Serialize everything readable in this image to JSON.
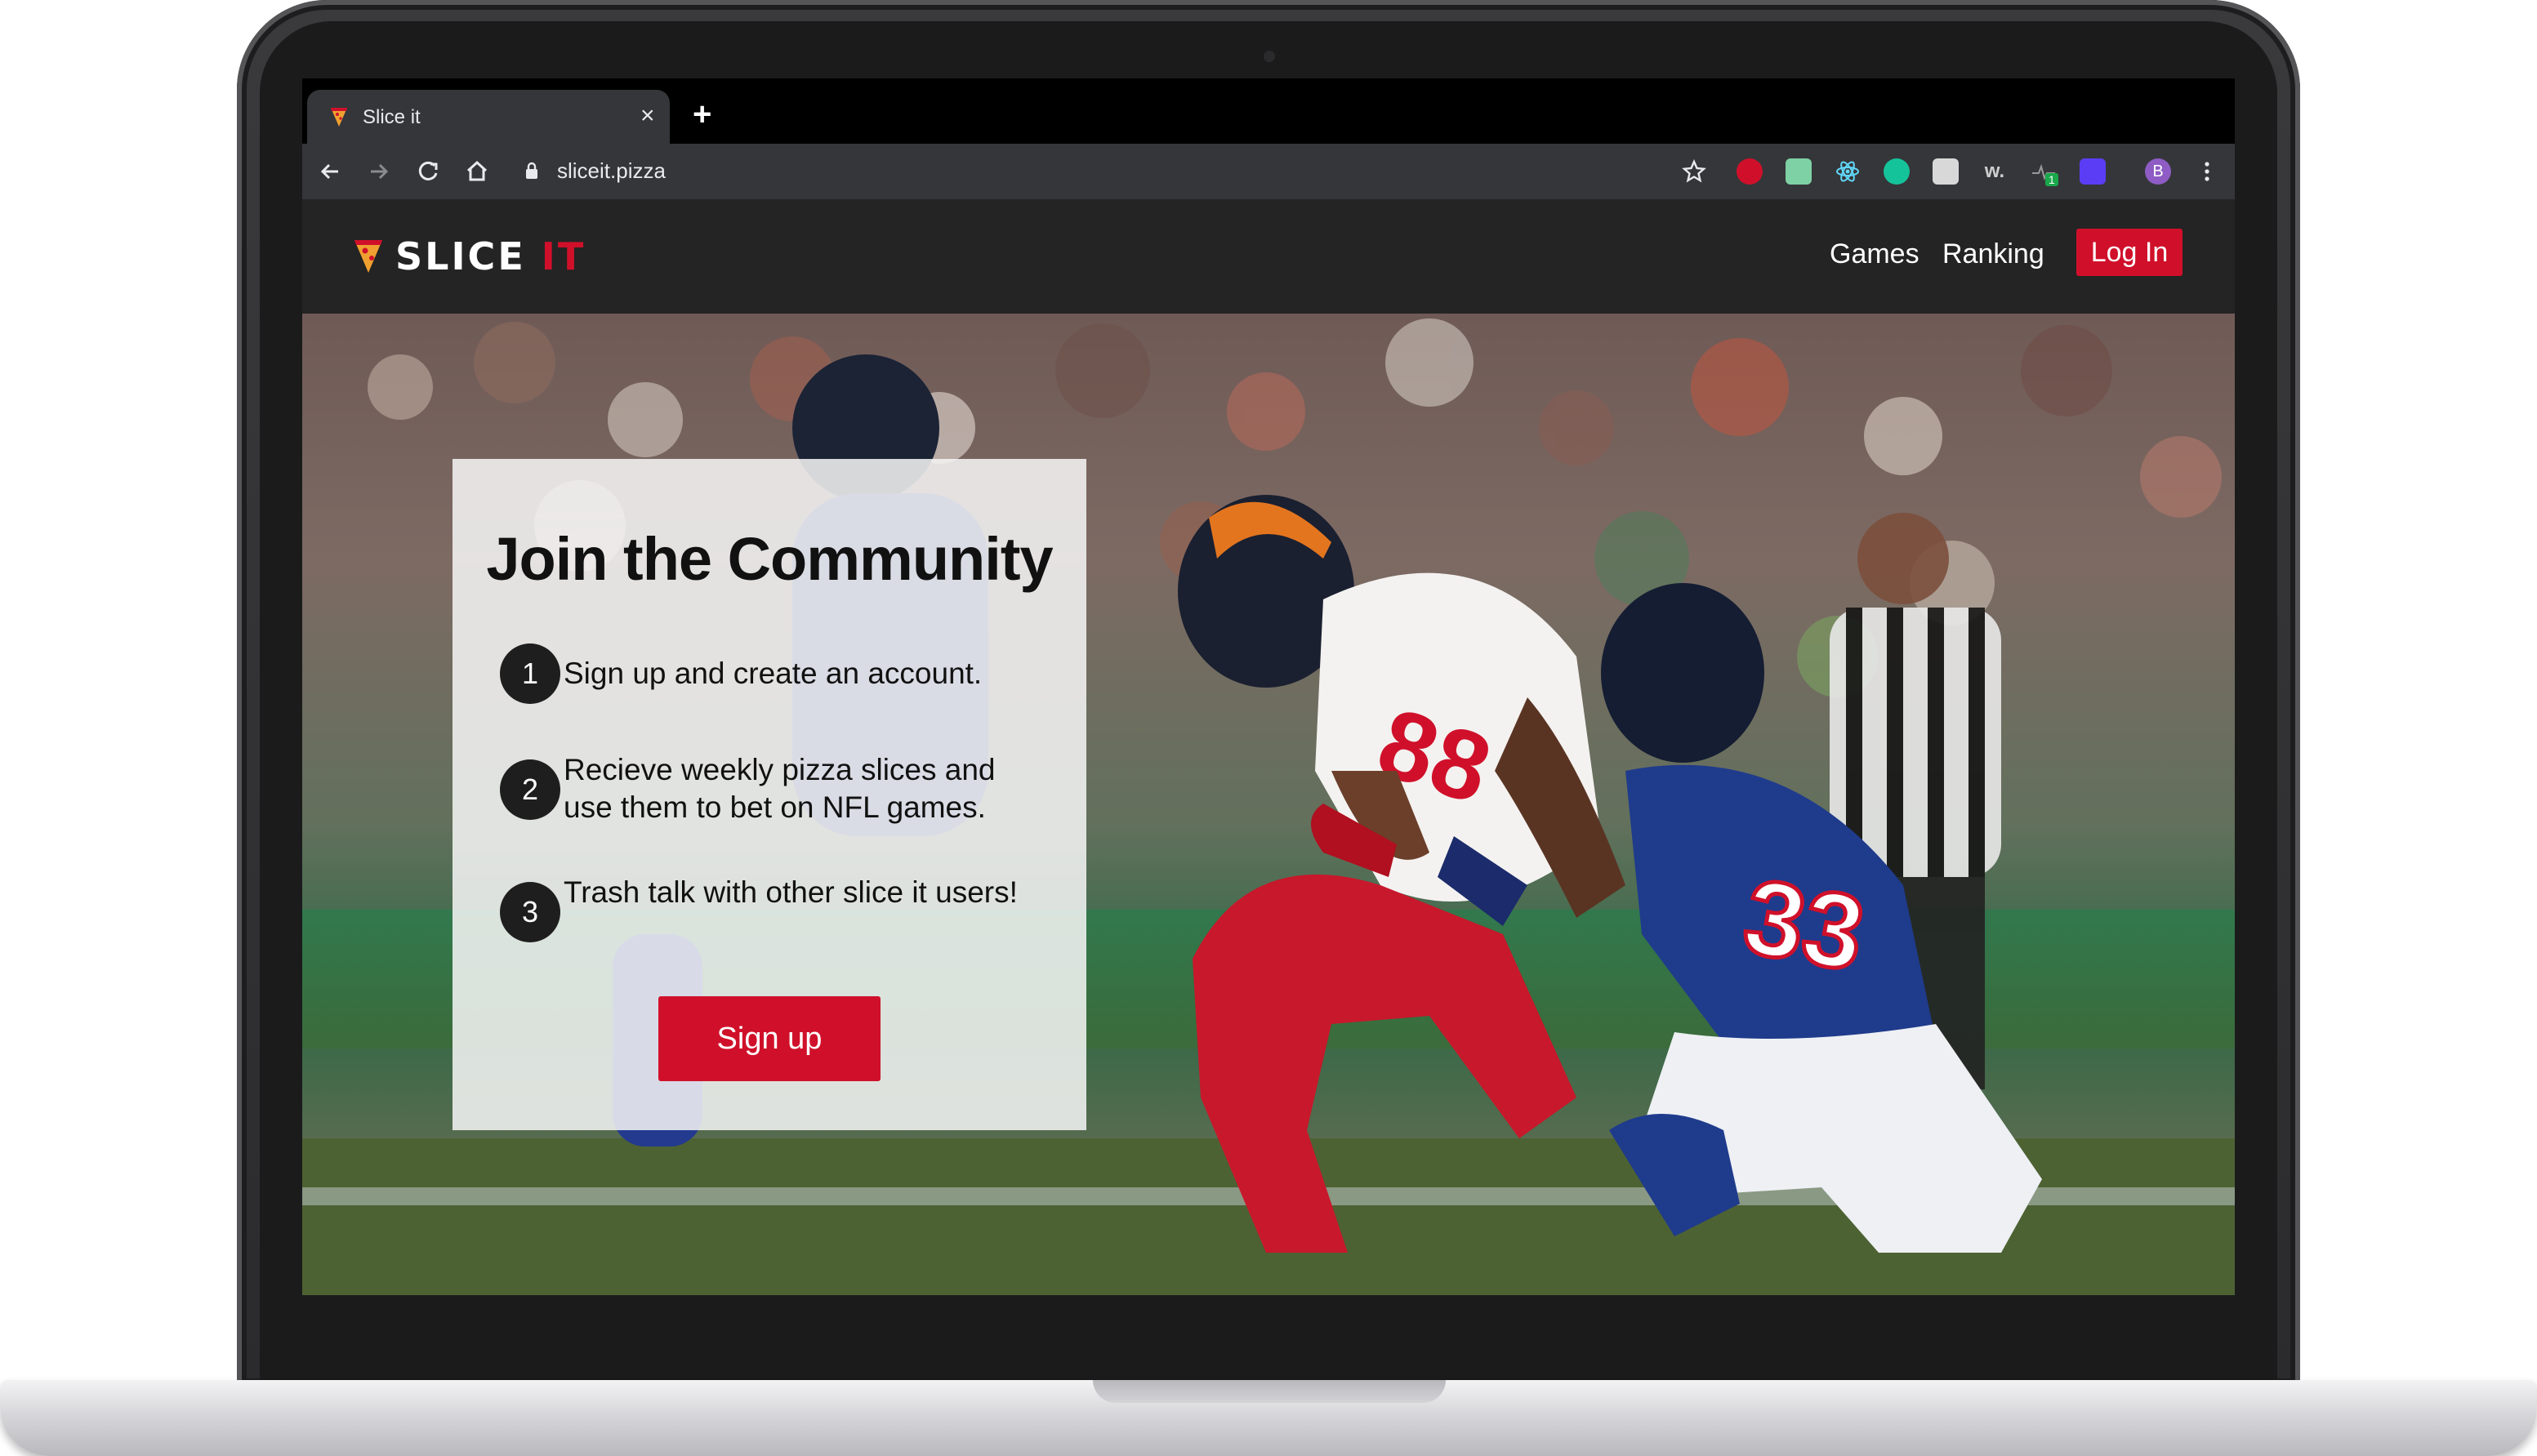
{
  "browser": {
    "tab_title": "Slice it",
    "tab_close": "×",
    "new_tab": "+",
    "url": "sliceit.pizza",
    "extension_badge": "1",
    "profile_initial": "B"
  },
  "site": {
    "logo_part1": "SLICE ",
    "logo_part2": "IT",
    "nav": {
      "games": "Games",
      "ranking": "Ranking",
      "login": "Log In"
    }
  },
  "hero": {
    "title": "Join the Community",
    "steps": [
      {
        "number": "1",
        "text": "Sign up and create an account."
      },
      {
        "number": "2",
        "text": "Recieve weekly pizza slices and use them to bet on NFL games."
      },
      {
        "number": "3",
        "text": "Trash talk with other slice it users!"
      }
    ],
    "signup": "Sign up",
    "jersey_left": "88",
    "jersey_right": "33"
  },
  "colors": {
    "brand_red": "#d0102a",
    "header_bg": "#242424",
    "browser_toolbar": "#35363a"
  },
  "icons": [
    "back-icon",
    "forward-icon",
    "reload-icon",
    "home-icon",
    "lock-icon",
    "star-icon",
    "more-icon",
    "pizza-slice-icon"
  ]
}
